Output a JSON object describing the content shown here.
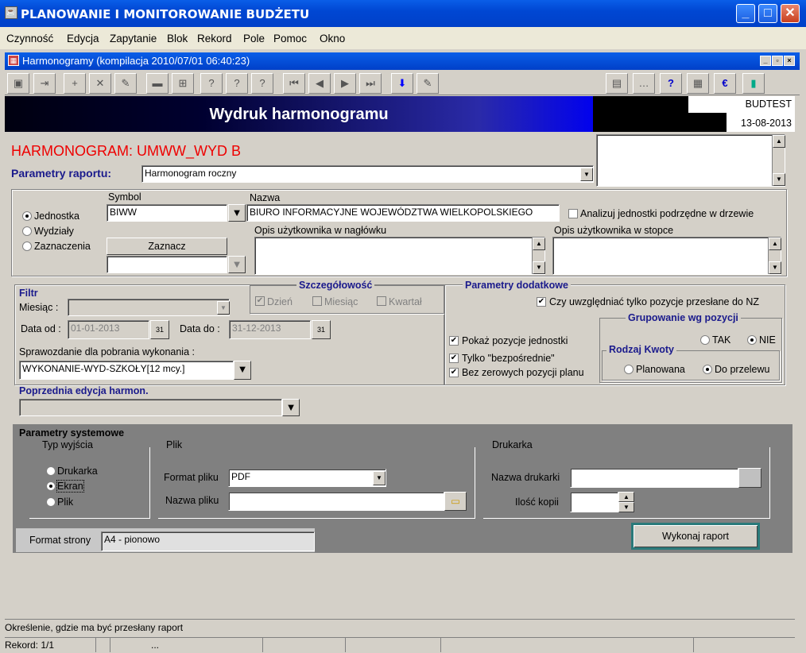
{
  "window": {
    "title": "PLANOWANIE I MONITOROWANIE BUDŻETU"
  },
  "menu": [
    "Czynność",
    "Edycja",
    "Zapytanie",
    "Blok",
    "Rekord",
    "Pole",
    "Pomoc",
    "Okno"
  ],
  "inner_window": {
    "title": "Harmonogramy (kompilacja 2010/07/01 06:40:23)"
  },
  "header": {
    "title": "Wydruk harmonogramu",
    "db": "BUDTEST",
    "date": "13-08-2013"
  },
  "form": {
    "harmonogram_label": "HARMONOGRAM: UMWW_WYD B",
    "params_label": "Parametry raportu:",
    "params_value": "Harmonogram roczny",
    "symbol_label": "Symbol",
    "symbol_value": "BIWW",
    "nazwa_label": "Nazwa",
    "nazwa_value": "BIURO INFORMACYJNE WOJEWÓDZTWA WIELKOPOLSKIEGO",
    "analizuj_label": "Analizuj jednostki podrzędne w drzewie",
    "radio_jednostka": "Jednostka",
    "radio_wydzialy": "Wydziały",
    "radio_zaznaczenia": "Zaznaczenia",
    "zaznacz_button": "Zaznacz",
    "opis_naglowek": "Opis użytkownika w nagłówku",
    "opis_stopka": "Opis użytkownika w stopce",
    "filtr_label": "Filtr",
    "miesiac_label": "Miesiąc :",
    "data_od_label": "Data od :",
    "data_od_value": "01-01-2013",
    "data_do_label": "Data do :",
    "data_do_value": "31-12-2013",
    "sprawozdanie_label": "Sprawozdanie dla pobrania wykonania :",
    "sprawozdanie_value": "WYKONANIE-WYD-SZKOŁY[12 mcy.]",
    "szczegolowosc_label": "Szczegółowość",
    "dzien": "Dzień",
    "miesiac": "Miesiąc",
    "kwartal": "Kwartał",
    "parametry_dodatkowe": "Parametry dodatkowe",
    "czy_uwzgledniac": "Czy uwzględniać tylko pozycje przesłane do NZ",
    "pokaz_pozycje": "Pokaż pozycje jednostki",
    "tylko_bezposrednie": "Tylko \"bezpośrednie\"",
    "bez_zerowych": "Bez zerowych pozycji planu",
    "grupowanie_label": "Grupowanie wg pozycji",
    "tak": "TAK",
    "nie": "NIE",
    "rodzaj_kwoty": "Rodzaj Kwoty",
    "planowana": "Planowana",
    "do_przelewu": "Do przelewu",
    "poprzednia_edycja": "Poprzednia edycja harmon."
  },
  "system": {
    "title": "Parametry systemowe",
    "typ_wyjscia": "Typ wyjścia",
    "drukarka_radio": "Drukarka",
    "ekran_radio": "Ekran",
    "plik_radio": "Plik",
    "plik_group": "Plik",
    "format_pliku_label": "Format pliku",
    "format_pliku_value": "PDF",
    "nazwa_pliku_label": "Nazwa pliku",
    "drukarka_group": "Drukarka",
    "nazwa_drukarki_label": "Nazwa drukarki",
    "ilosc_kopii_label": "Ilość kopii",
    "format_strony_label": "Format strony",
    "format_strony_value": "A4 - pionowo",
    "wykonaj_button": "Wykonaj raport"
  },
  "status": {
    "hint": "Określenie, gdzie ma być przesłany raport",
    "record": "Rekord: 1/1",
    "ellipsis": "..."
  }
}
